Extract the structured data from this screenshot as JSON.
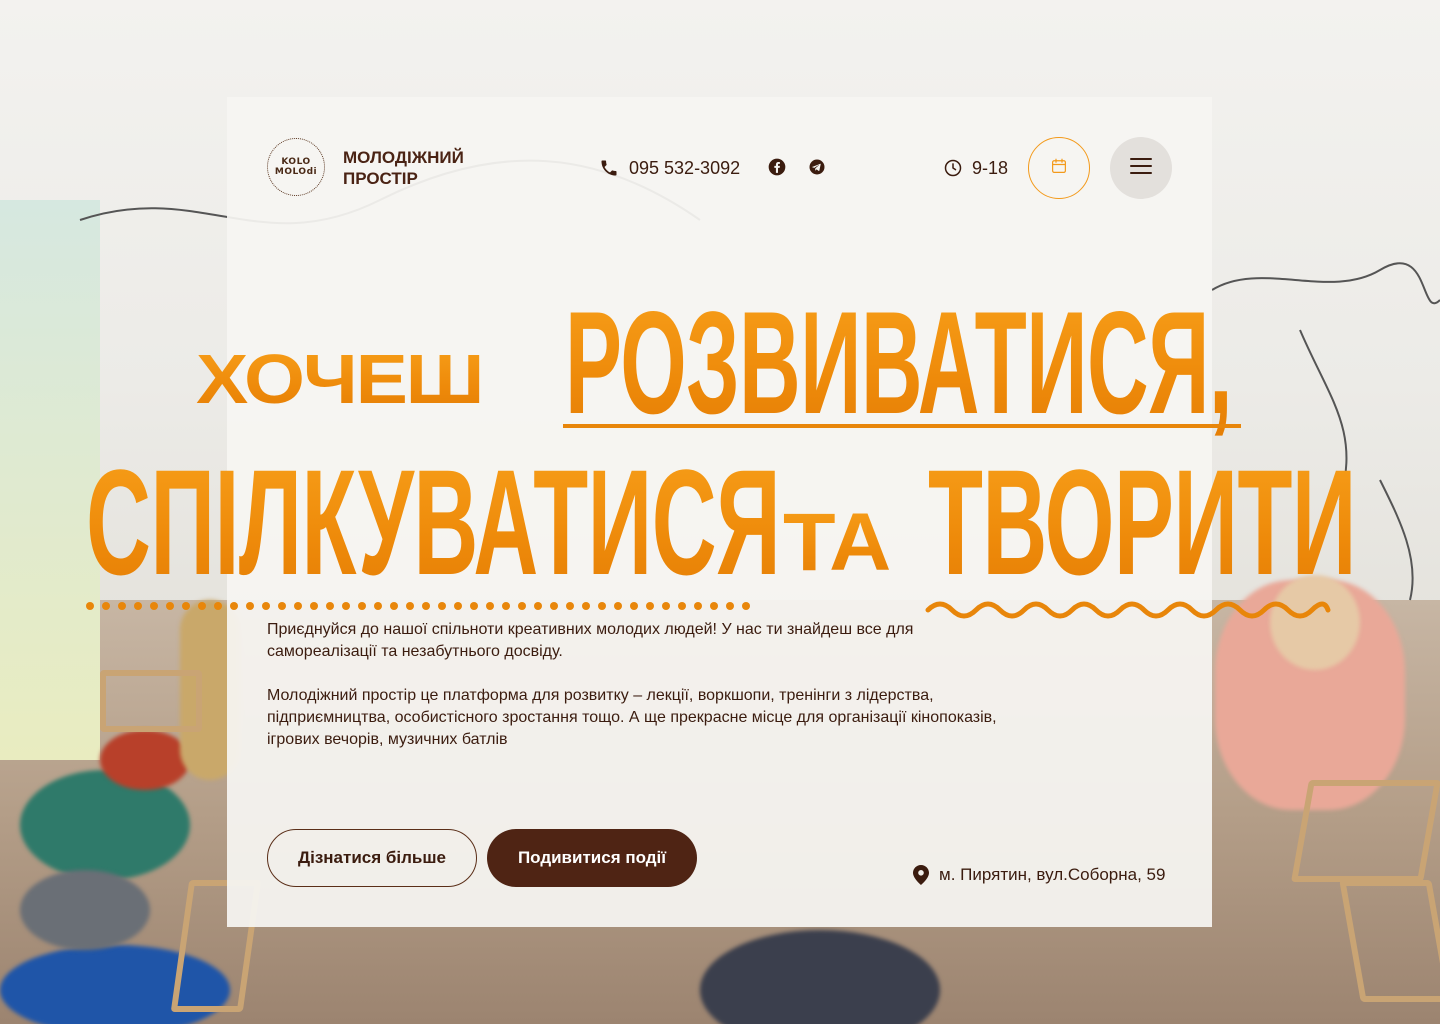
{
  "brand": {
    "logo_line1": "KOLO",
    "logo_line2": "MOLOdi",
    "name": "МОЛОДІЖНИЙ ПРОСТІР"
  },
  "header": {
    "phone": "095 532-3092",
    "hours": "9-18",
    "icons": [
      "phone-icon",
      "facebook-icon",
      "telegram-icon",
      "clock-icon",
      "calendar-icon",
      "hamburger-menu-icon"
    ]
  },
  "headline": {
    "part1": "ХОЧЕШ",
    "part2": "РОЗВИВАТИСЯ,",
    "part3": "СПІЛКУВАТИСЯ",
    "part4": "ТА",
    "part5": "ТВОРИТИ"
  },
  "body": {
    "paragraph1": "Приєднуйся до нашої спільноти креативних молодих людей! У нас ти знайдеш все для самореалізації та незабутнього досвіду.",
    "paragraph2": "Молодіжний простір це платформа для розвитку – лекції, воркшопи, тренінги з лідерства, підприємництва, особистісного зростання тощо. А ще прекрасне місце для організації кінопоказів, ігрових вечорів, музичних батлів"
  },
  "actions": {
    "learn_more": "Дізнатися більше",
    "view_events": "Подивитися події"
  },
  "address": "м. Пирятин, вул.Соборна, 59",
  "colors": {
    "accent_orange": "#F2900F",
    "dark_brown": "#4F2414",
    "card_bg": "#F6F5F2",
    "menu_button_bg": "#E3E0DC"
  }
}
